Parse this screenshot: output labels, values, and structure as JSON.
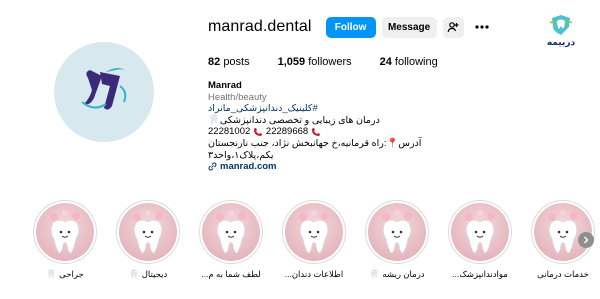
{
  "watermark": {
    "text": "دربیمه",
    "icon": "shield-tooth-logo-icon"
  },
  "profile": {
    "username": "manrad.dental",
    "avatar_icon": "manrad-logo-avatar",
    "follow_label": "Follow",
    "message_label": "Message",
    "suggest_icon": "add-person-icon",
    "more_icon": "more-dots-icon"
  },
  "stats": {
    "posts_count": "82",
    "posts_label": "posts",
    "followers_count": "1,059",
    "followers_label": "followers",
    "following_count": "24",
    "following_label": "following"
  },
  "bio": {
    "name": "Manrad",
    "category": "Health/beauty",
    "hashtag": "#کلینیک_دندانپزشکی_مانراد",
    "line1": "درمان های زیبایی و تخصصی دندانپزشکی🦷",
    "phone1": "22281002",
    "phone2": "22289668",
    "address": "آدرس📍:راه قرمانیه،خ جهانبخش نژاد، جنب نارنجستان یکم،پلاک۱،واحد۳",
    "link": "manrad.com",
    "link_icon": "link-icon"
  },
  "highlights": [
    {
      "label": "خدمات درمانی"
    },
    {
      "label": "موادندانپزشک..."
    },
    {
      "label": "درمان ریشه 🦷"
    },
    {
      "label": "اطلاعات دندان..."
    },
    {
      "label": "لطف شما به م..."
    },
    {
      "label": "دیجیتال 🦷"
    },
    {
      "label": "جراحی 🦷"
    }
  ],
  "next_icon": "chevron-right-icon",
  "colors": {
    "accent": "#0095f6",
    "link": "#00376b",
    "muted": "#737373",
    "brand": "#3b2a7a"
  }
}
